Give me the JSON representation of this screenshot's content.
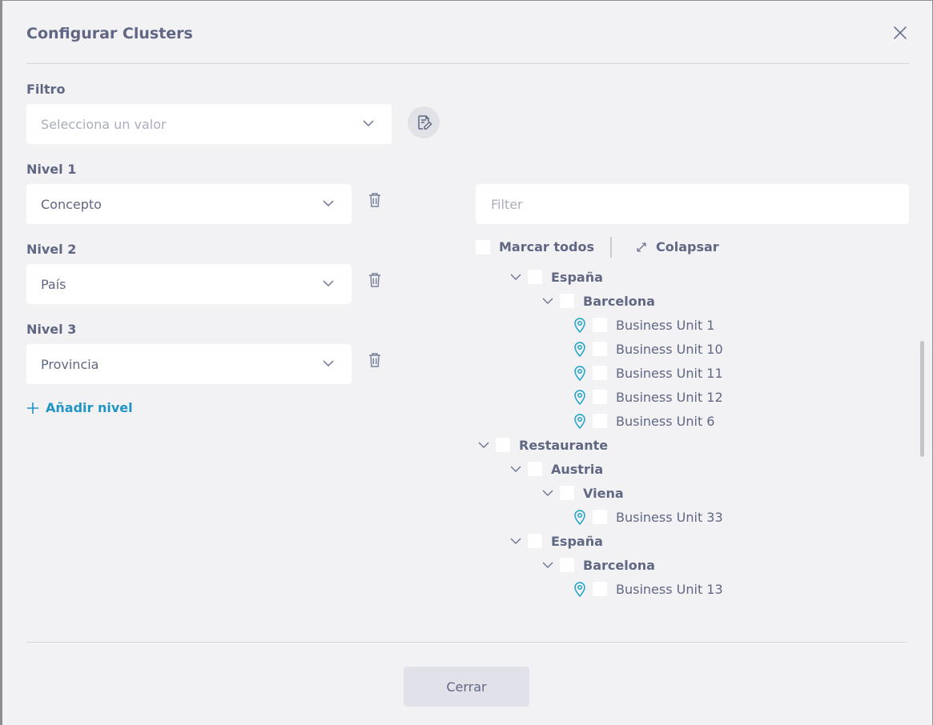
{
  "dialog": {
    "title": "Configurar Clusters",
    "close_label": "Cerrar"
  },
  "filter": {
    "label": "Filtro",
    "placeholder": "Selecciona un valor"
  },
  "levels": [
    {
      "label": "Nivel 1",
      "value": "Concepto"
    },
    {
      "label": "Nivel 2",
      "value": "País"
    },
    {
      "label": "Nivel 3",
      "value": "Provincia"
    }
  ],
  "add_level_label": "Añadir nivel",
  "tree_panel": {
    "filter_placeholder": "Filter",
    "mark_all_label": "Marcar todos",
    "collapse_label": "Colapsar"
  },
  "tree": [
    {
      "label": "España",
      "kind": "group"
    },
    {
      "label": "Barcelona",
      "kind": "group"
    },
    {
      "label": "Business Unit 1",
      "kind": "leaf"
    },
    {
      "label": "Business Unit 10",
      "kind": "leaf"
    },
    {
      "label": "Business Unit 11",
      "kind": "leaf"
    },
    {
      "label": "Business Unit 12",
      "kind": "leaf"
    },
    {
      "label": "Business Unit 6",
      "kind": "leaf"
    },
    {
      "label": "Restaurante",
      "kind": "group"
    },
    {
      "label": "Austria",
      "kind": "group"
    },
    {
      "label": "Viena",
      "kind": "group"
    },
    {
      "label": "Business Unit 33",
      "kind": "leaf"
    },
    {
      "label": "España",
      "kind": "group"
    },
    {
      "label": "Barcelona",
      "kind": "group"
    },
    {
      "label": "Business Unit 13",
      "kind": "leaf"
    }
  ],
  "colors": {
    "text": "#5f6783",
    "accent": "#1f94c5",
    "pin": "#1aa3c8",
    "background": "#f2f2f4"
  }
}
